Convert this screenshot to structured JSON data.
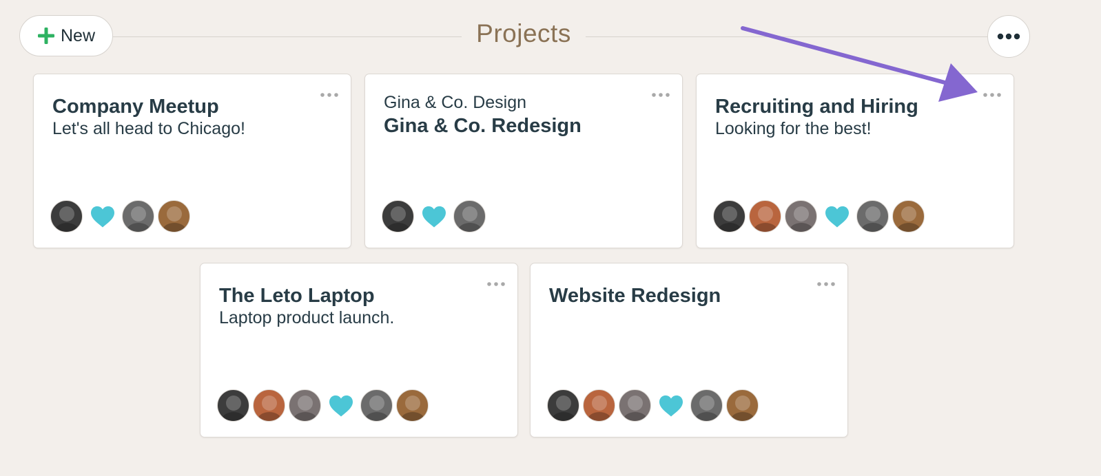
{
  "header": {
    "new_label": "New",
    "title": "Projects",
    "icons": {
      "new": "plus-icon",
      "more": "ellipsis-icon"
    }
  },
  "colors": {
    "background": "#f3efeb",
    "accent_green": "#2eb262",
    "title_brown": "#8a7255",
    "text_dark": "#283c46",
    "heart_teal": "#4cc6d6",
    "annotation_arrow": "#8467d0"
  },
  "projects": [
    {
      "company": "",
      "title": "Company Meetup",
      "description": "Let's all head to Chicago!",
      "people": [
        "avatar-bearded-man",
        "heart",
        "avatar-woman-glasses",
        "avatar-smiling-man"
      ]
    },
    {
      "company": "Gina & Co. Design",
      "title": "Gina & Co. Redesign",
      "description": "",
      "people": [
        "avatar-bearded-man",
        "heart",
        "avatar-woman-glasses"
      ]
    },
    {
      "company": "",
      "title": "Recruiting and Hiring",
      "description": "Looking for the best!",
      "people": [
        "avatar-bearded-man",
        "avatar-woman-sunglasses",
        "avatar-woman-hat",
        "heart",
        "avatar-woman-glasses",
        "avatar-smiling-man"
      ]
    },
    {
      "company": "",
      "title": "The Leto Laptop",
      "description": "Laptop product launch.",
      "people": [
        "avatar-bearded-man",
        "avatar-woman-sunglasses",
        "avatar-woman-hat",
        "heart",
        "avatar-woman-glasses",
        "avatar-smiling-man"
      ]
    },
    {
      "company": "",
      "title": "Website Redesign",
      "description": "",
      "people": [
        "avatar-bearded-man",
        "avatar-woman-sunglasses",
        "avatar-woman-hat",
        "heart",
        "avatar-woman-glasses",
        "avatar-smiling-man"
      ]
    }
  ]
}
